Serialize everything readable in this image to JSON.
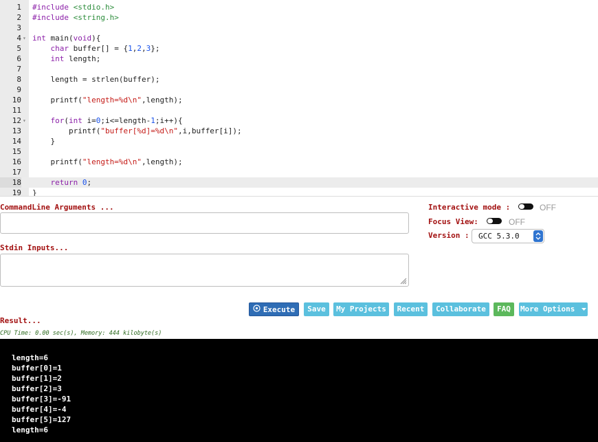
{
  "editor": {
    "lines": [
      {
        "num": "1",
        "code": "#include <stdio.h>"
      },
      {
        "num": "2",
        "code": "#include <string.h>"
      },
      {
        "num": "3",
        "code": ""
      },
      {
        "num": "4",
        "code": "int main(void){"
      },
      {
        "num": "5",
        "code": "    char buffer[] = {1,2,3};"
      },
      {
        "num": "6",
        "code": "    int length;"
      },
      {
        "num": "7",
        "code": ""
      },
      {
        "num": "8",
        "code": "    length = strlen(buffer);"
      },
      {
        "num": "9",
        "code": ""
      },
      {
        "num": "10",
        "code": "    printf(\"length=%d\\n\",length);"
      },
      {
        "num": "11",
        "code": ""
      },
      {
        "num": "12",
        "code": "    for(int i=0;i<=length-1;i++){"
      },
      {
        "num": "13",
        "code": "        printf(\"buffer[%d]=%d\\n\",i,buffer[i]);"
      },
      {
        "num": "14",
        "code": "    }"
      },
      {
        "num": "15",
        "code": ""
      },
      {
        "num": "16",
        "code": "    printf(\"length=%d\\n\",length);"
      },
      {
        "num": "17",
        "code": ""
      },
      {
        "num": "18",
        "code": "    return 0;"
      },
      {
        "num": "19",
        "code": "}"
      }
    ]
  },
  "args": {
    "label": "CommandLine Arguments ..."
  },
  "stdin": {
    "label": "Stdin Inputs..."
  },
  "options": {
    "interactive_label": "Interactive mode :",
    "interactive_state": "OFF",
    "focus_label": "Focus View:",
    "focus_state": "OFF",
    "version_label": "Version :",
    "version_value": "GCC 5.3.0"
  },
  "buttons": {
    "execute": "Execute",
    "save": "Save",
    "projects": "My Projects",
    "recent": "Recent",
    "collaborate": "Collaborate",
    "faq": "FAQ",
    "more": "More Options"
  },
  "result": {
    "label": "Result...",
    "stats": "CPU Time: 0.00 sec(s), Memory: 444 kilobyte(s)",
    "output": [
      "length=6",
      "buffer[0]=1",
      "buffer[1]=2",
      "buffer[2]=3",
      "buffer[3]=-91",
      "buffer[4]=-4",
      "buffer[5]=127",
      "length=6"
    ]
  },
  "colors": {
    "label_red": "#a21010",
    "execute_blue": "#2f6db5",
    "light_blue": "#5bc0de",
    "faq_green": "#5cb85c"
  }
}
